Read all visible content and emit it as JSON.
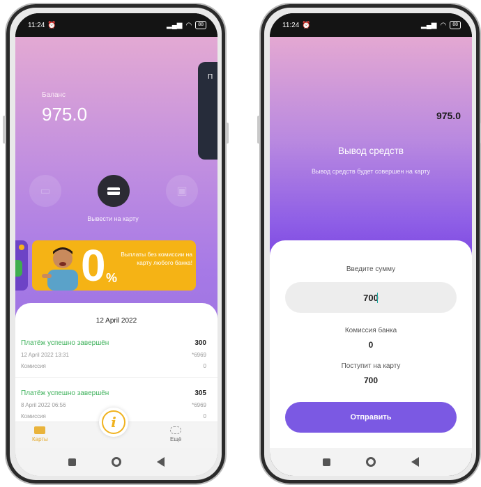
{
  "status_bar": {
    "time": "11:24",
    "battery": "88"
  },
  "left": {
    "balance_label": "Баланс",
    "balance_value": "975.0",
    "side_panel_char": "П",
    "withdraw_label": "Вывести на карту",
    "promo": {
      "big": "0",
      "pct": "%",
      "text": "Выплаты без комиссии на карту любого банка!"
    },
    "date_header": "12 April 2022",
    "transactions": [
      {
        "title": "Платёж успешно завершён",
        "amount": "300",
        "date": "12 April 2022 13:31",
        "card": "*6969",
        "fee_label": "Комиссия",
        "fee": "0"
      },
      {
        "title": "Платёж успешно завершён",
        "amount": "305",
        "date": "8 April 2022 06:56",
        "card": "*6969",
        "fee_label": "Комиссия",
        "fee": "0"
      }
    ],
    "tabs": {
      "cards": "Карты",
      "more": "Ещё"
    },
    "info_symbol": "i"
  },
  "right": {
    "balance": "975.0",
    "title": "Вывод средств",
    "subtitle": "Вывод средств будет совершен на карту",
    "amount_label": "Введите сумму",
    "amount_value": "700",
    "fee_label": "Комиссия банка",
    "fee_value": "0",
    "receive_label": "Поступит на карту",
    "receive_value": "700",
    "submit_label": "Отправить"
  },
  "colors": {
    "success": "#3db15a",
    "accent": "#7b59e3",
    "promo": "#f5b315",
    "tab_active": "#e5a92a"
  },
  "icons": [
    "alarm-icon",
    "signal-icon",
    "wifi-icon",
    "battery-icon",
    "wallet-icon",
    "card-icon",
    "gift-icon",
    "info-icon",
    "cards-tab-icon",
    "more-tab-icon",
    "nav-recent-icon",
    "nav-home-icon",
    "nav-back-icon"
  ]
}
